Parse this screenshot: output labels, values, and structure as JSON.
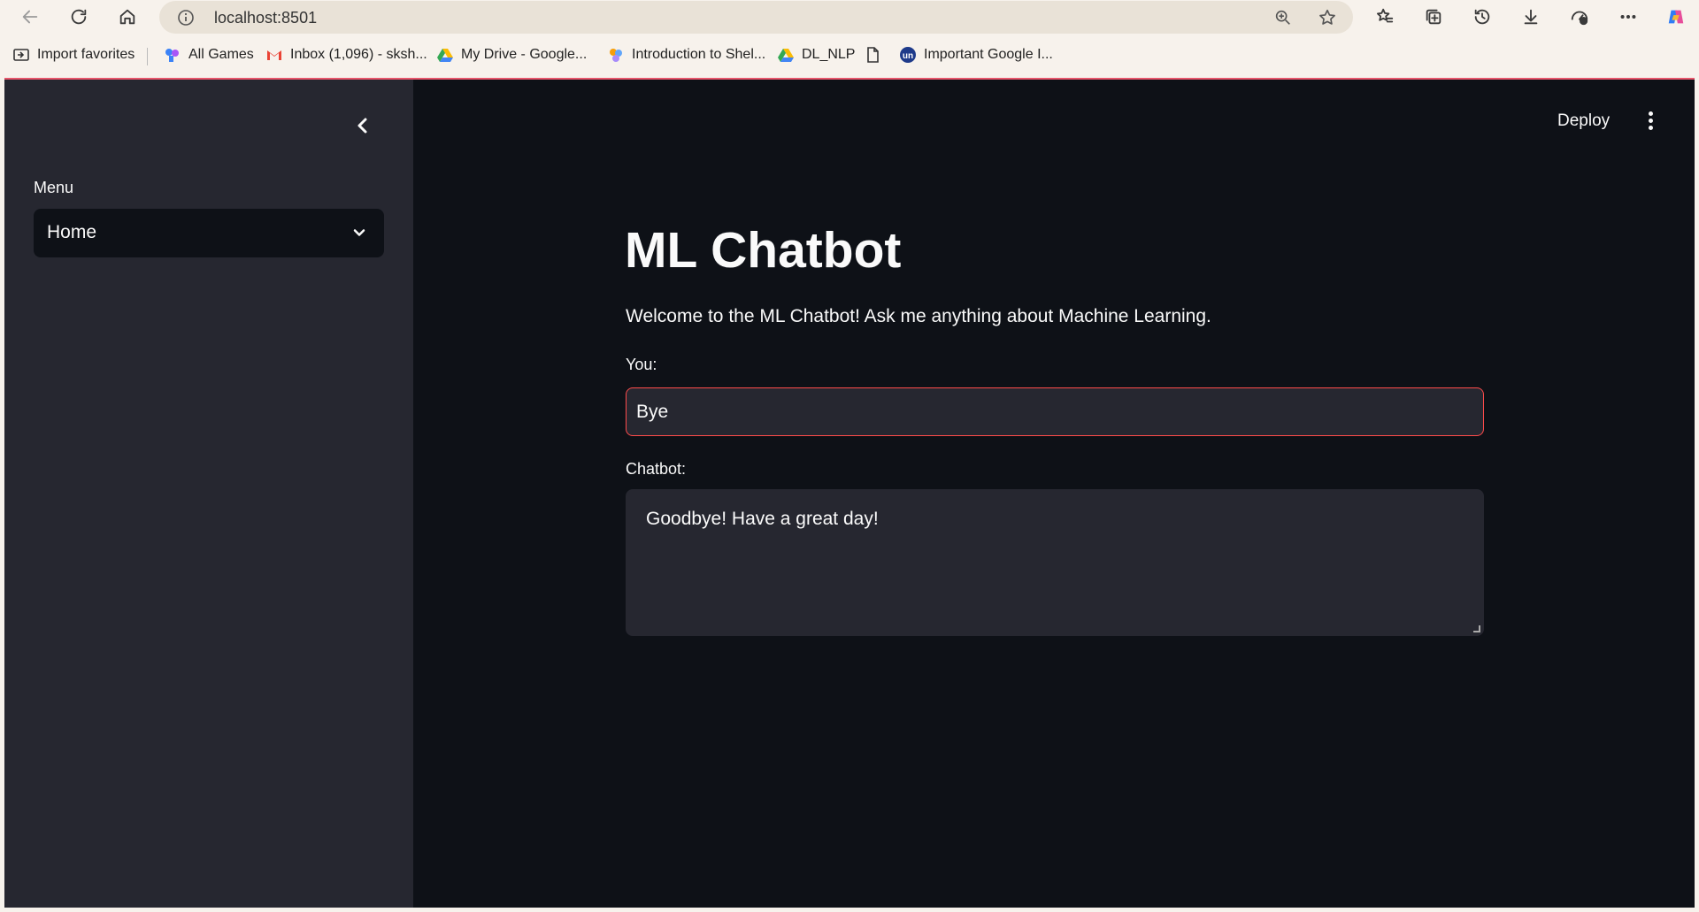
{
  "browser": {
    "url": "localhost:8501",
    "favorites": [
      {
        "label": "Import favorites",
        "icon": "import-icon"
      },
      {
        "label": "All Games",
        "icon": "games-icon"
      },
      {
        "label": "Inbox (1,096) - sksh...",
        "icon": "gmail-icon"
      },
      {
        "label": "My Drive - Google...",
        "icon": "drive-icon"
      },
      {
        "label": "Introduction to Shel...",
        "icon": "shell-icon"
      },
      {
        "label": "DL_NLP",
        "icon": "drive-icon"
      },
      {
        "label": "",
        "icon": "document-icon"
      },
      {
        "label": "Important Google I...",
        "icon": "un-icon"
      }
    ]
  },
  "sidebar": {
    "menu_label": "Menu",
    "selected": "Home"
  },
  "header": {
    "deploy_label": "Deploy"
  },
  "main": {
    "title": "ML Chatbot",
    "welcome": "Welcome to the ML Chatbot! Ask me anything about Machine Learning.",
    "you_label": "You:",
    "you_value": "Bye",
    "chatbot_label": "Chatbot:",
    "chatbot_response": "Goodbye! Have a great day!"
  },
  "colors": {
    "accent": "#ff4b4b",
    "background": "#0e1117",
    "sidebar": "#262730"
  }
}
